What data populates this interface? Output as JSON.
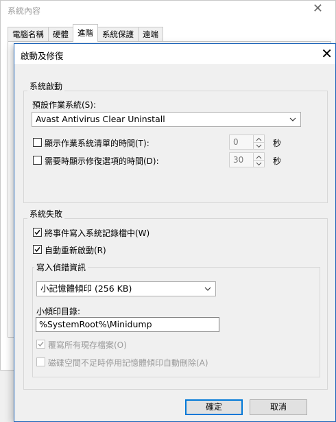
{
  "background_window": {
    "title": "系統內容",
    "tabs": [
      "電腦名稱",
      "硬體",
      "進階",
      "系統保護",
      "遠端"
    ],
    "active_tab_index": 2
  },
  "dialog": {
    "title": "啟動及修復",
    "system_startup": {
      "group_label": "系統啟動",
      "default_os_label": "預設作業系統(S):",
      "default_os_value": "Avast Antivirus Clear Uninstall",
      "show_os_list": {
        "label": "顯示作業系統清單的時間(T):",
        "checked": false,
        "value": "0",
        "unit": "秒"
      },
      "show_recovery": {
        "label": "需要時顯示修復選項的時間(D):",
        "checked": false,
        "value": "30",
        "unit": "秒"
      }
    },
    "system_failure": {
      "group_label": "系統失敗",
      "write_event": {
        "label": "將事件寫入系統記錄檔中(W)",
        "checked": true
      },
      "auto_restart": {
        "label": "自動重新啟動(R)",
        "checked": true
      },
      "debug_info": {
        "group_label": "寫入偵錯資訊",
        "dump_type_value": "小記憶體傾印 (256 KB)",
        "dump_dir_label": "小傾印目錄:",
        "dump_dir_value": "%SystemRoot%\\Minidump",
        "overwrite": {
          "label": "覆寫所有現存檔案(O)",
          "checked": true,
          "enabled": false
        },
        "disable_auto_delete": {
          "label": "磁碟空間不足時停用記憶體傾印自動刪除(A)",
          "checked": false,
          "enabled": false
        }
      }
    },
    "ok_label": "確定",
    "cancel_label": "取消"
  }
}
